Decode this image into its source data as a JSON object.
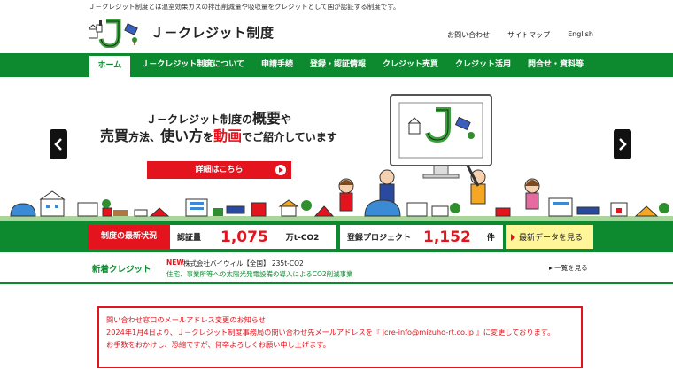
{
  "header": {
    "tagline": "Ｊ－クレジット制度とは温室効果ガスの排出削減量や吸収量をクレジットとして国が認証する制度です。",
    "site_title": "Ｊ－クレジット制度",
    "top_links": [
      "お問い合わせ",
      "サイトマップ",
      "English"
    ]
  },
  "nav": {
    "items": [
      "ホーム",
      "Ｊ－クレジット制度について",
      "申請手続",
      "登録・認証情報",
      "クレジット売買",
      "クレジット活用",
      "問合せ・資料等"
    ],
    "active_index": 0
  },
  "hero": {
    "line1_prefix": "Ｊ－クレジット制度の",
    "line1_em": "概要",
    "line1_suffix": "や",
    "line2_a": "売買",
    "line2_b": "方法、",
    "line2_c": "使い方",
    "line2_d": "を",
    "line2_e": "動画",
    "line2_f": "でご紹介しています",
    "button_label": "詳細はこちら",
    "monitor_logo_text": "J"
  },
  "stats": {
    "label": "制度の最新状況",
    "certified_label": "認証量",
    "certified_value": "1,075",
    "certified_unit": "万t-CO2",
    "projects_label": "登録プロジェクト",
    "projects_value": "1,152",
    "projects_unit": "件",
    "latest_button": "最新データを見る"
  },
  "news": {
    "label": "新着クレジット",
    "new_badge": "NEW",
    "title": "株式会社バイウィル【全国】 235t-CO2",
    "description": "住宅、事業所等への太陽光発電設備の導入によるCO2削減事業",
    "more_link": "一覧を見る"
  },
  "notice": {
    "lines": [
      "問い合わせ窓口のメールアドレス変更のお知らせ",
      "2024年1月4日より、Ｊ－クレジット制度事務局の問い合わせ先メールアドレスを『 jcre-info@mizuho-rt.co.jp 』に変更しております。",
      "お手数をおかけし、恐縮ですが、何卒よろしくお願い申し上げます。"
    ]
  },
  "colors": {
    "brand_green": "#0d8a30",
    "accent_red": "#e4141e",
    "highlight_yellow": "#fff69a"
  },
  "icons": {
    "logo": "j-credit-logo-icon",
    "prev": "chevron-left-icon",
    "next": "chevron-right-icon",
    "play": "play-icon"
  }
}
